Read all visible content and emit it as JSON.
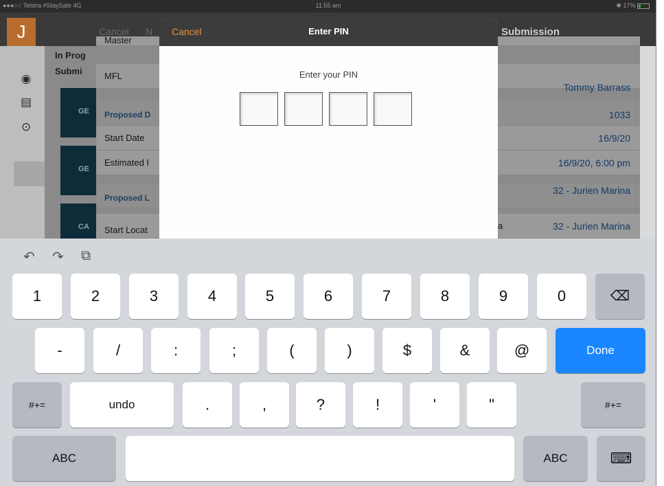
{
  "status": {
    "carrier": "●●●○○ Telstra #StaySafe  4G",
    "time": "11:55 am",
    "battery": "17%"
  },
  "app": {
    "logo_glyph": "J",
    "bg_cancel": "Cancel",
    "bg_title_fragment": "N",
    "bg_title_right": "Submission"
  },
  "sidebar": {
    "icons": [
      "radar-icon",
      "document-icon",
      "lifebuoy-icon"
    ]
  },
  "midcol": {
    "in_progress": "In Prog",
    "submitted": "Submi",
    "tiles": [
      "GE",
      "GE",
      "CA"
    ]
  },
  "detail": {
    "rows": [
      {
        "label": "Master",
        "value": ""
      },
      {
        "label": "MFL",
        "value": "Tommy Barrass"
      },
      {
        "label": "Proposed D",
        "value": "1033",
        "header": true
      },
      {
        "label": "Start Date",
        "value": "16/9/20"
      },
      {
        "label": "Estimated I",
        "value": "16/9/20, 6:00 pm"
      },
      {
        "label": "Proposed L",
        "value": "32 - Jurien Marina",
        "header": true
      },
      {
        "label": "Start Locat",
        "value": "32 - Jurien Marina",
        "mid": "a"
      }
    ]
  },
  "modal": {
    "cancel": "Cancel",
    "title": "Enter PIN",
    "prompt": "Enter your PIN",
    "pin_count": 4
  },
  "keyboard": {
    "toolbar": [
      "undo-icon",
      "redo-icon",
      "paste-icon"
    ],
    "row1": [
      "1",
      "2",
      "3",
      "4",
      "5",
      "6",
      "7",
      "8",
      "9",
      "0"
    ],
    "row2": [
      "-",
      "/",
      ":",
      ";",
      "(",
      ")",
      "$",
      "&",
      "@"
    ],
    "done": "Done",
    "row3_left": "#+=",
    "undo": "undo",
    "row3": [
      ".",
      ",",
      "?",
      "!",
      "'",
      "\""
    ],
    "row3_right": "#+=",
    "abc_left": "ABC",
    "abc_right": "ABC",
    "colors": {
      "done": "#1a86ff",
      "accent": "#e69139"
    }
  }
}
